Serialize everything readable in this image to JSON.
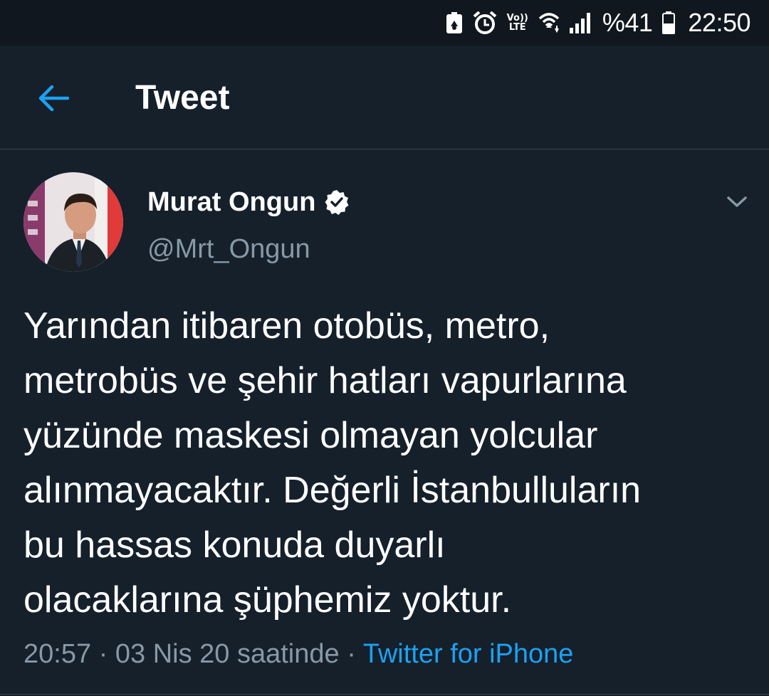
{
  "status_bar": {
    "lte_top": "Vo))",
    "lte_bottom": "LTE",
    "battery": "%41",
    "time": "22:50",
    "icons": [
      "battery-saver-icon",
      "alarm-icon",
      "volte-icon",
      "wifi-icon",
      "signal-icon",
      "battery-icon"
    ]
  },
  "header": {
    "title": "Tweet",
    "back_icon": "arrow-left-icon"
  },
  "tweet": {
    "author_name": "Murat Ongun",
    "author_handle": "@Mrt_Ongun",
    "verified_icon": "verified-badge-icon",
    "more_icon": "chevron-down-icon",
    "text_lines": [
      "Yarından itibaren otobüs, metro,",
      "metrobüs ve şehir hatları vapurlarına",
      "yüzünde maskesi olmayan yolcular",
      "alınmayacaktır. Değerli İstanbulluların",
      "bu hassas konuda duyarlı",
      "olacaklarına şüphemiz yoktur."
    ],
    "time": "20:57",
    "separator": "·",
    "date": "03 Nis 20 saatinde",
    "source": "Twitter for iPhone"
  },
  "colors": {
    "background": "#15202b",
    "status_bar": "#10171e",
    "accent": "#1da1f2",
    "secondary_text": "#8899a6",
    "divider": "#38444d"
  }
}
